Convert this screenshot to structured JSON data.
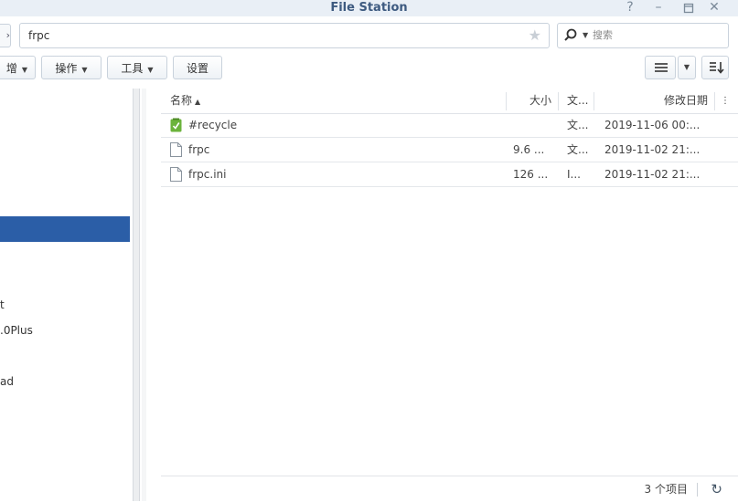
{
  "window": {
    "title": "File Station"
  },
  "path_bar": {
    "path": "frpc",
    "search_placeholder": "搜索"
  },
  "toolbar": {
    "create_label": "增",
    "action_label": "操作",
    "tools_label": "工具",
    "settings_label": "设置"
  },
  "left_panel": {
    "items": [
      "t",
      ".0Plus",
      "ad"
    ]
  },
  "file_list": {
    "columns": {
      "name": "名称",
      "size": "大小",
      "type": "文...",
      "modified": "修改日期"
    },
    "rows": [
      {
        "name": "#recycle",
        "size": "",
        "type": "文...",
        "modified": "2019-11-06 00:...",
        "icon": "recycle-folder-icon"
      },
      {
        "name": "frpc",
        "size": "9.6 ...",
        "type": "文...",
        "modified": "2019-11-02 21:...",
        "icon": "file-icon"
      },
      {
        "name": "frpc.ini",
        "size": "126 ...",
        "type": "I...",
        "modified": "2019-11-02 21:...",
        "icon": "file-icon"
      }
    ]
  },
  "status": {
    "item_count": "3 个项目"
  }
}
